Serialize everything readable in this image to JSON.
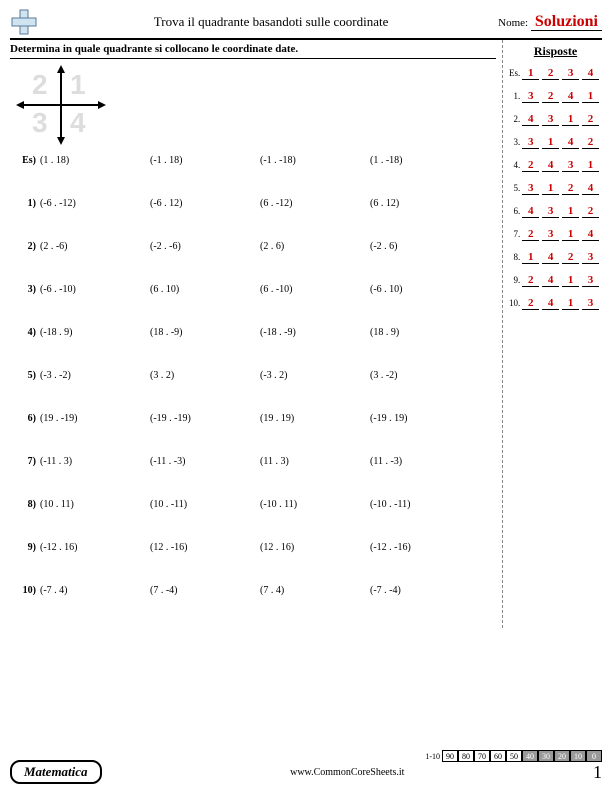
{
  "header": {
    "title": "Trova il quadrante basandoti sulle coordinate",
    "name_label": "Nome:",
    "solutions": "Soluzioni"
  },
  "instruction": "Determina in quale quadrante si collocano le coordinate date.",
  "diagram_quadrants": {
    "q1": "1",
    "q2": "2",
    "q3": "3",
    "q4": "4"
  },
  "example_label": "Es)",
  "problems": [
    {
      "n": "Es)",
      "coords": [
        "(1 . 18)",
        "(-1 . 18)",
        "(-1 . -18)",
        "(1 . -18)"
      ]
    },
    {
      "n": "1)",
      "coords": [
        "(-6 . -12)",
        "(-6 . 12)",
        "(6 . -12)",
        "(6 . 12)"
      ]
    },
    {
      "n": "2)",
      "coords": [
        "(2 . -6)",
        "(-2 . -6)",
        "(2 . 6)",
        "(-2 . 6)"
      ]
    },
    {
      "n": "3)",
      "coords": [
        "(-6 . -10)",
        "(6 . 10)",
        "(6 . -10)",
        "(-6 . 10)"
      ]
    },
    {
      "n": "4)",
      "coords": [
        "(-18 . 9)",
        "(18 . -9)",
        "(-18 . -9)",
        "(18 . 9)"
      ]
    },
    {
      "n": "5)",
      "coords": [
        "(-3 . -2)",
        "(3 . 2)",
        "(-3 . 2)",
        "(3 . -2)"
      ]
    },
    {
      "n": "6)",
      "coords": [
        "(19 . -19)",
        "(-19 . -19)",
        "(19 . 19)",
        "(-19 . 19)"
      ]
    },
    {
      "n": "7)",
      "coords": [
        "(-11 . 3)",
        "(-11 . -3)",
        "(11 . 3)",
        "(11 . -3)"
      ]
    },
    {
      "n": "8)",
      "coords": [
        "(10 . 11)",
        "(10 . -11)",
        "(-10 . 11)",
        "(-10 . -11)"
      ]
    },
    {
      "n": "9)",
      "coords": [
        "(-12 . 16)",
        "(12 . -16)",
        "(12 . 16)",
        "(-12 . -16)"
      ]
    },
    {
      "n": "10)",
      "coords": [
        "(-7 . 4)",
        "(7 . -4)",
        "(7 . 4)",
        "(-7 . -4)"
      ]
    }
  ],
  "answers_title": "Risposte",
  "answers": [
    {
      "label": "Es.",
      "vals": [
        "1",
        "2",
        "3",
        "4"
      ]
    },
    {
      "label": "1.",
      "vals": [
        "3",
        "2",
        "4",
        "1"
      ]
    },
    {
      "label": "2.",
      "vals": [
        "4",
        "3",
        "1",
        "2"
      ]
    },
    {
      "label": "3.",
      "vals": [
        "3",
        "1",
        "4",
        "2"
      ]
    },
    {
      "label": "4.",
      "vals": [
        "2",
        "4",
        "3",
        "1"
      ]
    },
    {
      "label": "5.",
      "vals": [
        "3",
        "1",
        "2",
        "4"
      ]
    },
    {
      "label": "6.",
      "vals": [
        "4",
        "3",
        "1",
        "2"
      ]
    },
    {
      "label": "7.",
      "vals": [
        "2",
        "3",
        "1",
        "4"
      ]
    },
    {
      "label": "8.",
      "vals": [
        "1",
        "4",
        "2",
        "3"
      ]
    },
    {
      "label": "9.",
      "vals": [
        "2",
        "4",
        "1",
        "3"
      ]
    },
    {
      "label": "10.",
      "vals": [
        "2",
        "4",
        "1",
        "3"
      ]
    }
  ],
  "footer": {
    "subject": "Matematica",
    "url": "www.CommonCoreSheets.it",
    "page": "1"
  },
  "score_strip": {
    "label": "1-10",
    "cells": [
      "90",
      "80",
      "70",
      "60",
      "50",
      "40",
      "30",
      "20",
      "10",
      "0"
    ],
    "shaded_from": 5
  }
}
